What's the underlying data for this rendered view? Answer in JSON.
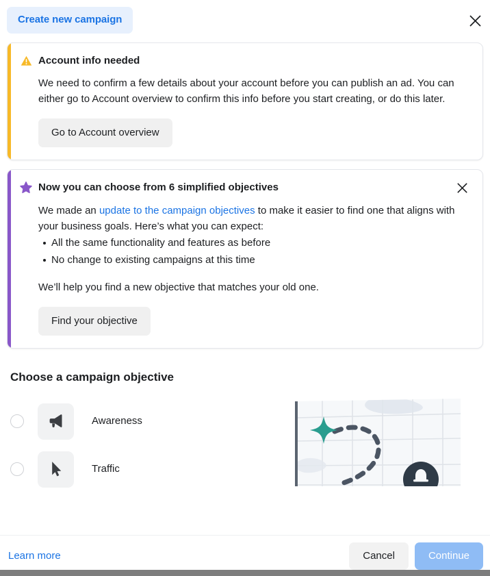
{
  "header": {
    "tab_label": "Create new campaign",
    "close_icon": "close-icon"
  },
  "alerts": [
    {
      "type": "warning",
      "accent_color": "#f7b928",
      "icon": "warning-triangle-icon",
      "title": "Account info needed",
      "body": "We need to confirm a few details about your account before you can publish an ad. You can either go to Account overview to confirm this info before you start creating, or do this later.",
      "button_label": "Go to Account overview",
      "dismissible": false
    },
    {
      "type": "info",
      "accent_color": "#8957c9",
      "icon": "star-icon",
      "title": "Now you can choose from 6 simplified objectives",
      "body_prefix": "We made an ",
      "link_text": "update to the campaign objectives",
      "link_color": "#1b74e4",
      "body_suffix": " to make it easier to find one that aligns with your business goals. Here’s what you can expect:",
      "bullets": [
        "All the same functionality and features as before",
        "No change to existing campaigns at this time"
      ],
      "closing_text": "We’ll help you find a new objective that matches your old one.",
      "button_label": "Find your objective",
      "dismissible": true,
      "close_icon": "close-icon"
    }
  ],
  "objective_section": {
    "title": "Choose a campaign objective",
    "options": [
      {
        "label": "Awareness",
        "icon": "megaphone-icon",
        "selected": false
      },
      {
        "label": "Traffic",
        "icon": "cursor-arrow-icon",
        "selected": false
      }
    ]
  },
  "illustration": {
    "name": "campaign-objective-illustration",
    "star_color": "#2a9d8f",
    "grid_color": "#dfe3e8",
    "path_color": "#4b5563"
  },
  "footer": {
    "learn_more_label": "Learn more",
    "cancel_label": "Cancel",
    "continue_label": "Continue",
    "continue_enabled": false
  }
}
